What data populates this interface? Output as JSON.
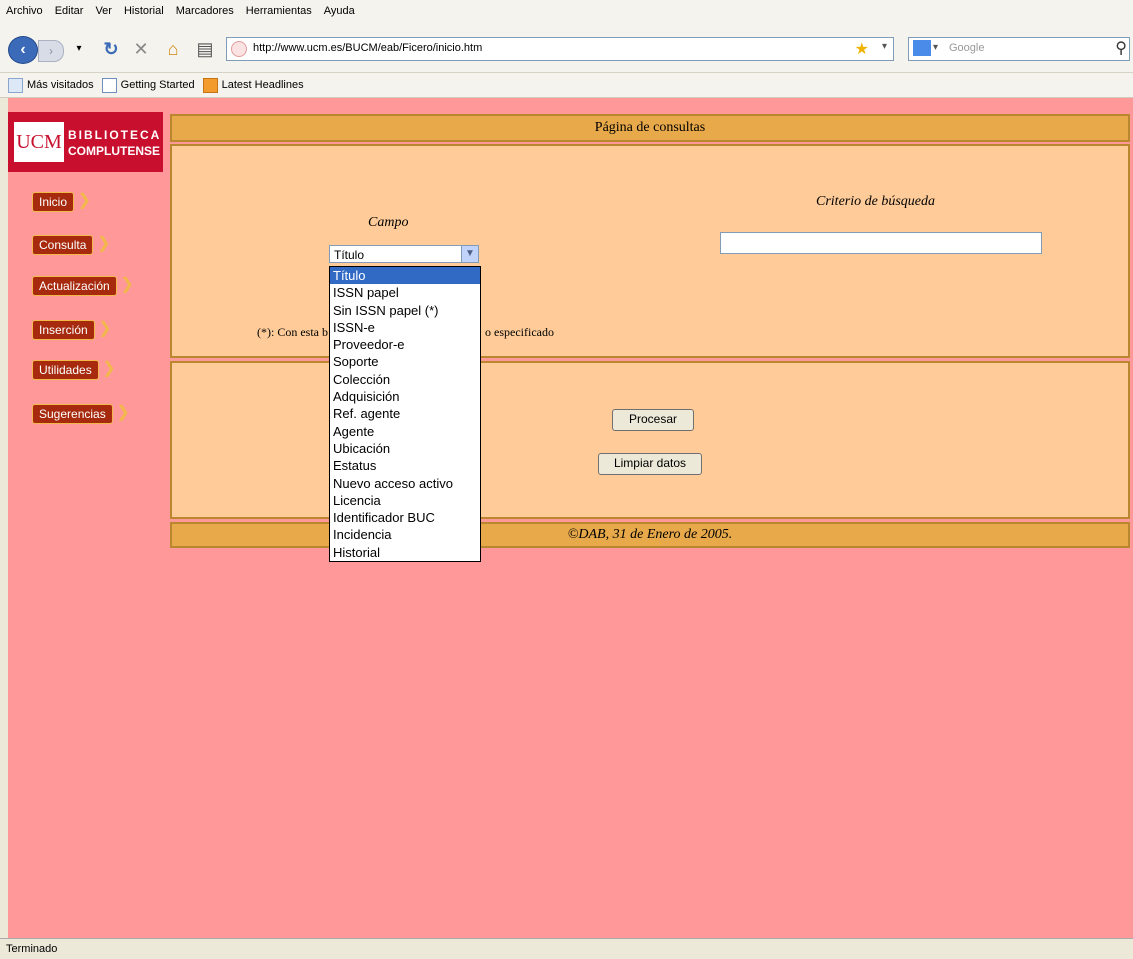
{
  "menu": [
    "Archivo",
    "Editar",
    "Ver",
    "Historial",
    "Marcadores",
    "Herramientas",
    "Ayuda"
  ],
  "browser": {
    "url": "http://www.ucm.es/BUCM/eab/Ficero/inicio.htm",
    "search_placeholder": "Google"
  },
  "bookmarks": [
    "Más visitados",
    "Getting Started",
    "Latest Headlines"
  ],
  "logo": {
    "ucm": "UCM",
    "line1": "BIBLIOTECA",
    "line2": "COMPLUTENSE"
  },
  "sidebar": [
    "Inicio",
    "Consulta",
    "Actualización",
    "Inserción",
    "Utilidades",
    "Sugerencias"
  ],
  "page": {
    "title": "Página de consultas",
    "campo_label": "Campo",
    "criterio_label": "Criterio de búsqueda",
    "selected_field": "Título",
    "note_left": "(*): Con esta b",
    "note_right": "o especificado",
    "process_button": "Procesar",
    "clear_button": "Limpiar datos",
    "footer": "©DAB, 31 de Enero de 2005."
  },
  "dropdown_options": [
    "Título",
    "ISSN papel",
    "Sin ISSN papel (*)",
    "ISSN-e",
    "Proveedor-e",
    "Soporte",
    "Colección",
    "Adquisición",
    "Ref. agente",
    "Agente",
    "Ubicación",
    "Estatus",
    "Nuevo acceso activo",
    "Licencia",
    "Identificador BUC",
    "Incidencia",
    "Historial"
  ],
  "status": "Terminado"
}
